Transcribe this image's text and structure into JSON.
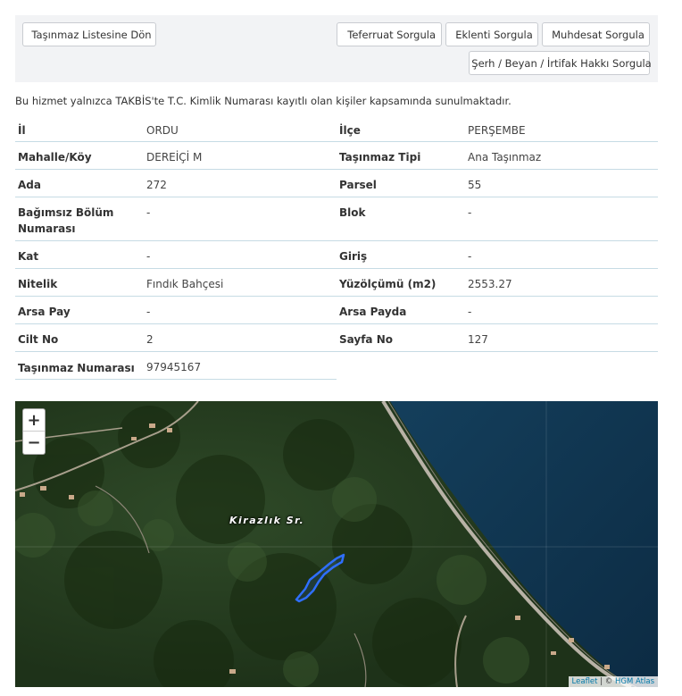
{
  "toolbar": {
    "back_label": "Taşınmaz Listesine Dön",
    "teferruat_label": "Teferruat Sorgula",
    "eklenti_label": "Eklenti Sorgula",
    "muhdesat_label": "Muhdesat Sorgula",
    "serh_label": "Şerh / Beyan / İrtifak Hakkı Sorgula"
  },
  "notice": "Bu hizmet yalnızca TAKBİS'te T.C. Kimlik Numarası kayıtlı olan kişiler kapsamında sunulmaktadır.",
  "fields": {
    "il": {
      "label": "İl",
      "value": "ORDU"
    },
    "ilce": {
      "label": "İlçe",
      "value": "PERŞEMBE"
    },
    "mahalle": {
      "label": "Mahalle/Köy",
      "value": "DEREİÇİ M"
    },
    "tasinmaz_tipi": {
      "label": "Taşınmaz Tipi",
      "value": "Ana Taşınmaz"
    },
    "ada": {
      "label": "Ada",
      "value": "272"
    },
    "parsel": {
      "label": "Parsel",
      "value": "55"
    },
    "bagimsiz_bolum_line1": "Bağımsız Bölüm",
    "bagimsiz_bolum_line2": "Numarası",
    "bagimsiz_bolum_value": "-",
    "blok": {
      "label": "Blok",
      "value": "-"
    },
    "kat": {
      "label": "Kat",
      "value": "-"
    },
    "giris": {
      "label": "Giriş",
      "value": "-"
    },
    "nitelik": {
      "label": "Nitelik",
      "value": "Fındık Bahçesi"
    },
    "yuzolcumu": {
      "label": "Yüzölçümü (m2)",
      "value": "2553.27"
    },
    "arsa_pay": {
      "label": "Arsa Pay",
      "value": "-"
    },
    "arsa_payda": {
      "label": "Arsa Payda",
      "value": "-"
    },
    "cilt_no": {
      "label": "Cilt No",
      "value": "2"
    },
    "sayfa_no": {
      "label": "Sayfa No",
      "value": "127"
    },
    "tasinmaz_numarasi": {
      "label": "Taşınmaz Numarası",
      "value": "97945167"
    }
  },
  "map": {
    "zoom_in": "+",
    "zoom_out": "−",
    "place_label": "Kirazlık Sr.",
    "attribution_leaflet": "Leaflet",
    "attribution_sep": " | © ",
    "attribution_source": "HGM Atlas",
    "parcel_color": "#2f6fff",
    "sea_color": "#0f3550",
    "land_color": "#243b20"
  },
  "icons": {
    "back": "chevron-left-icon",
    "search": "magnifier-icon"
  }
}
